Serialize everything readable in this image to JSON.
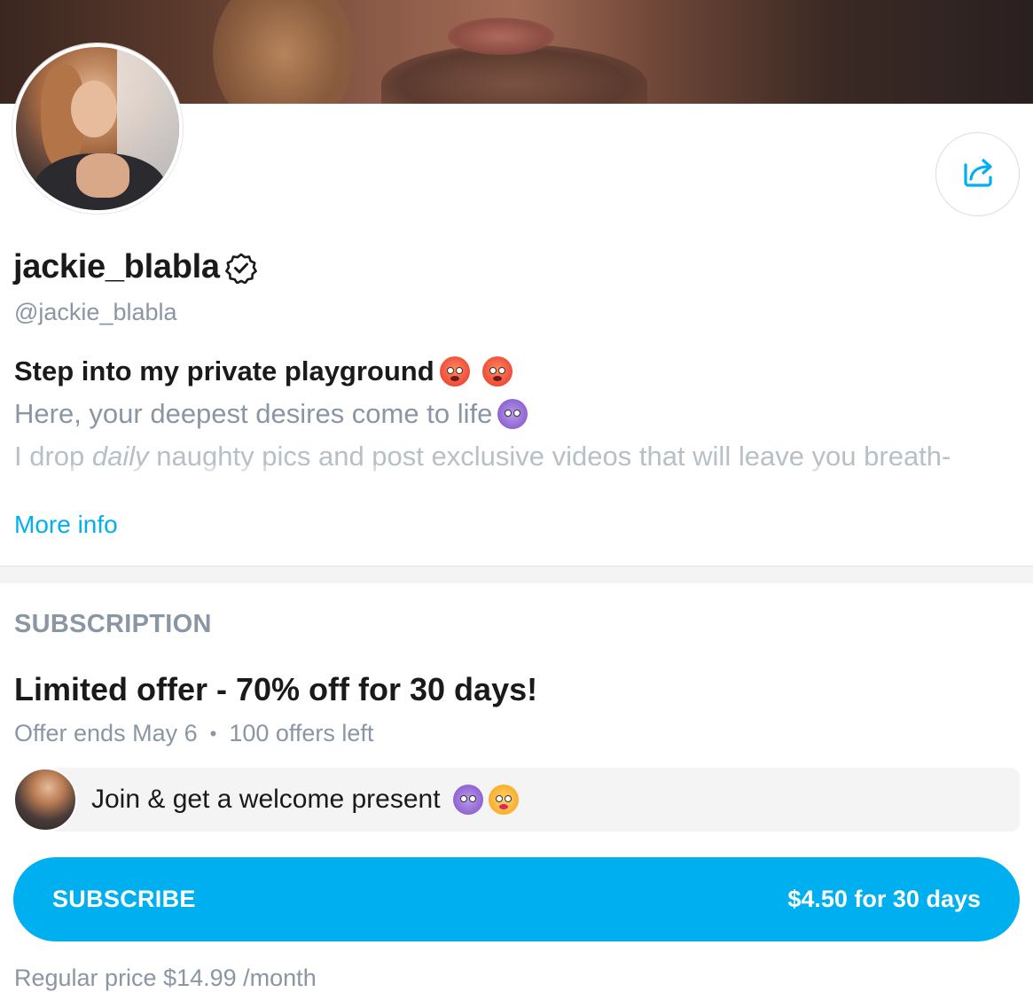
{
  "profile": {
    "display_name": "jackie_blabla",
    "handle": "@jackie_blabla",
    "verified": true,
    "share_icon": "share-icon"
  },
  "bio": {
    "line1": "Step into my private playground",
    "line1_emojis": [
      "hot-face-emoji",
      "hot-face-emoji"
    ],
    "line2": "Here, your deepest desires come to life",
    "line2_emoji": "smiling-devil-emoji",
    "line3_pre": "I drop",
    "line3_em": "daily",
    "line3_post": "naughty pics and post exclusive videos that will leave you breath-",
    "more_info": "More info"
  },
  "subscription": {
    "section_label": "SUBSCRIPTION",
    "offer_title": "Limited offer - 70% off for 30 days!",
    "offer_ends": "Offer ends May 6",
    "separator": "•",
    "offers_left": "100 offers left",
    "welcome_message": "Join & get a welcome present",
    "welcome_emojis": [
      "smiling-devil-emoji",
      "kissing-face-emoji"
    ],
    "subscribe_label": "SUBSCRIBE",
    "subscribe_price": "$4.50 for 30 days",
    "regular_price": "Regular price $14.99 /month"
  },
  "colors": {
    "accent": "#00aff0",
    "muted_text": "#8a96a3",
    "primary_text": "#1a1a1a"
  }
}
